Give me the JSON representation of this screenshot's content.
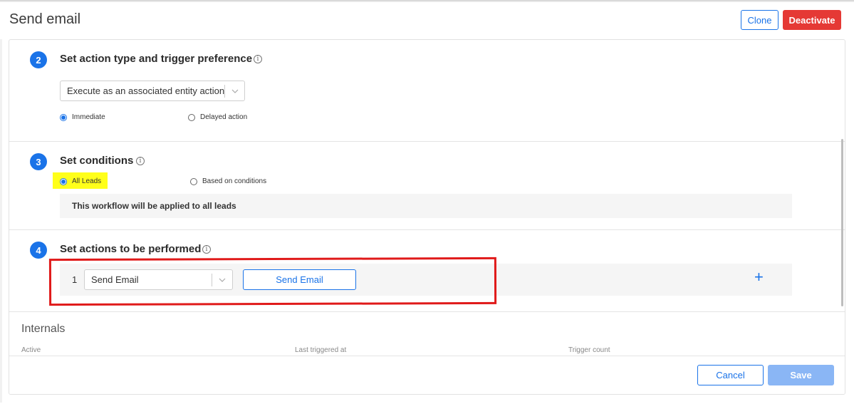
{
  "header": {
    "title": "Send email",
    "clone_label": "Clone",
    "deactivate_label": "Deactivate"
  },
  "step2": {
    "number": "2",
    "title": "Set action type and trigger preference",
    "info_icon": "info-icon",
    "action_type_select": "Execute as an associated entity action",
    "options": [
      {
        "label": "Immediate",
        "selected": true
      },
      {
        "label": "Delayed action",
        "selected": false
      }
    ]
  },
  "step3": {
    "number": "3",
    "title": "Set conditions",
    "info_icon": "info-icon",
    "options": [
      {
        "label": "All Leads",
        "selected": true
      },
      {
        "label": "Based on conditions",
        "selected": false
      }
    ],
    "note": "This workflow will be applied to all leads",
    "highlight_color": "#ffff1a"
  },
  "step4": {
    "number": "4",
    "title": "Set actions to be performed",
    "info_icon": "info-icon",
    "actions": [
      {
        "index": "1",
        "select_value": "Send Email",
        "button_label": "Send Email"
      }
    ],
    "add_icon": "plus-icon",
    "annotation_color": "#e01a1a"
  },
  "internals": {
    "title": "Internals",
    "columns": [
      "Active",
      "Last triggered at",
      "Trigger count"
    ]
  },
  "footer": {
    "cancel_label": "Cancel",
    "save_label": "Save"
  },
  "colors": {
    "accent": "#1a73e8",
    "danger": "#e53935",
    "save_disabled": "#8ab6f5"
  }
}
